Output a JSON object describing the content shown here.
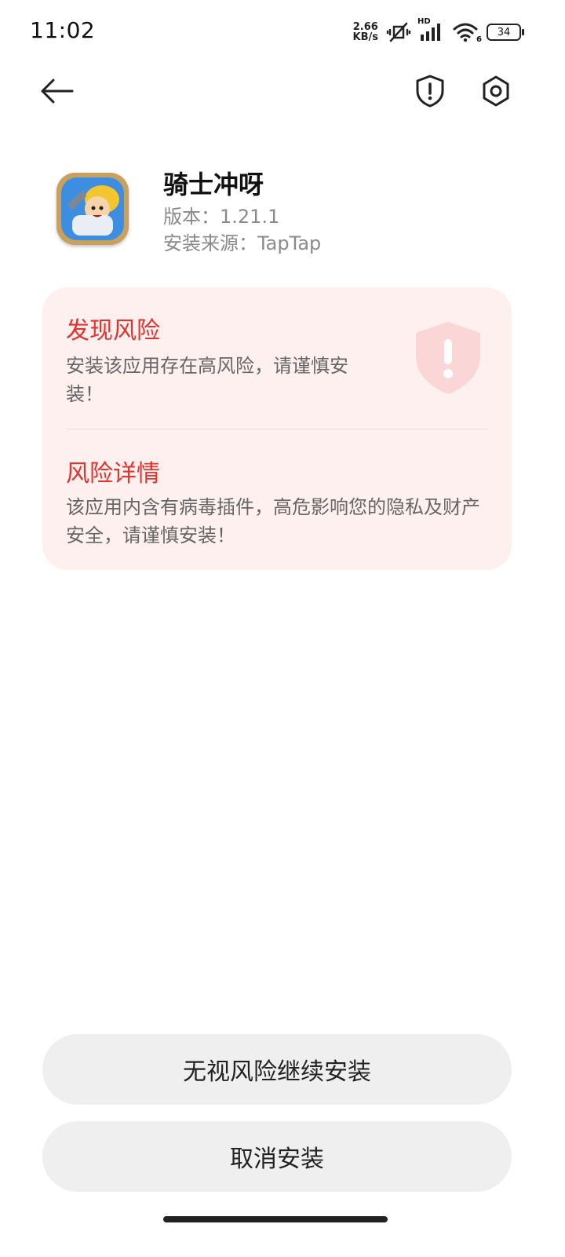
{
  "status_bar": {
    "time": "11:02",
    "net_speed_value": "2.66",
    "net_speed_unit": "KB/s",
    "hd_label": "HD",
    "wifi_label": "6",
    "battery": "34",
    "icons": [
      "mute-vibrate-icon",
      "signal-icon",
      "wifi-icon",
      "battery-icon"
    ]
  },
  "header": {
    "icons": [
      "back-arrow-icon",
      "shield-alert-icon",
      "settings-gear-icon"
    ]
  },
  "app": {
    "name": "骑士冲呀",
    "version": "版本：1.21.1",
    "source": "安装来源：TapTap"
  },
  "risk": {
    "title": "发现风险",
    "description": "安装该应用存在高风险，请谨慎安装！",
    "detail_title": "风险详情",
    "detail_description": "该应用内含有病毒插件，高危影响您的隐私及财产安全，请谨慎安装！",
    "accent_color": "#e5322d",
    "card_color": "#fdf0ef"
  },
  "actions": {
    "continue_label": "无视风险继续安装",
    "cancel_label": "取消安装"
  }
}
